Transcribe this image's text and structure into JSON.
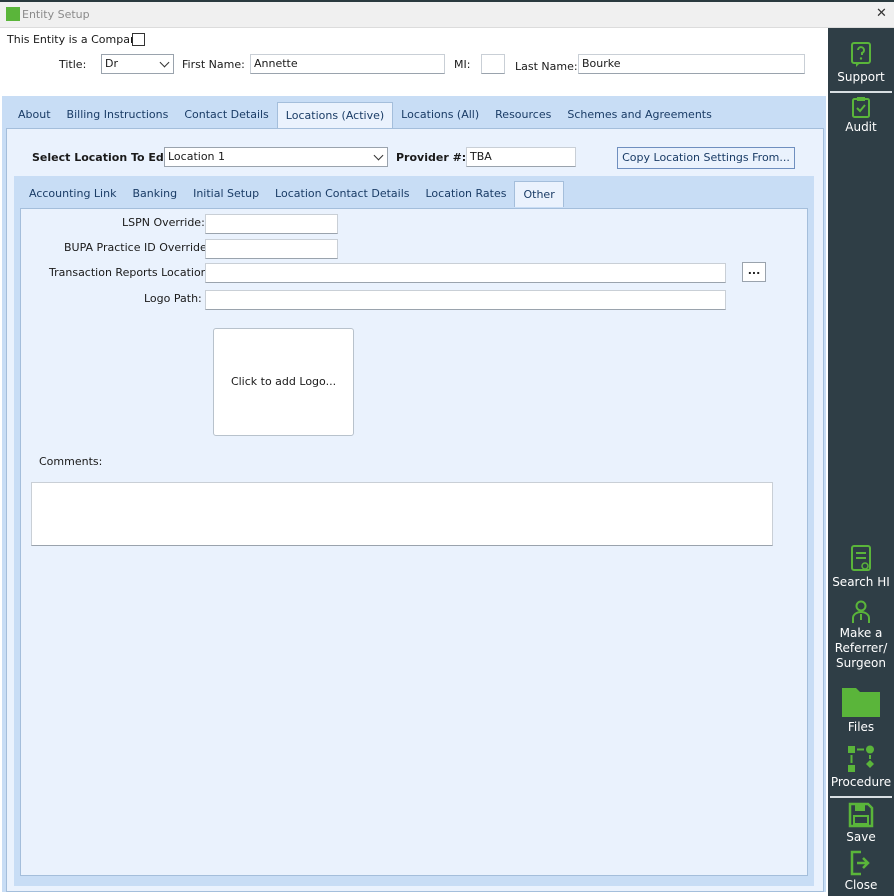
{
  "window": {
    "title": "Entity Setup",
    "close_glyph": "✕"
  },
  "header": {
    "is_company_label": "This Entity is a Company",
    "title_label": "Title:",
    "title_value": "Dr",
    "first_name_label": "First Name:",
    "first_name_value": "Annette",
    "mi_label": "MI:",
    "mi_value": "",
    "last_name_label": "Last Name:",
    "last_name_value": "Bourke"
  },
  "main_tabs": [
    {
      "label": "About"
    },
    {
      "label": "Billing Instructions"
    },
    {
      "label": "Contact Details"
    },
    {
      "label": "Locations (Active)"
    },
    {
      "label": "Locations (All)"
    },
    {
      "label": "Resources"
    },
    {
      "label": "Schemes and Agreements"
    }
  ],
  "location": {
    "select_label": "Select Location To Edit:",
    "select_value": "Location 1",
    "provider_label": "Provider #:",
    "provider_value": "TBA",
    "copy_button": "Copy Location Settings From..."
  },
  "sub_tabs": [
    {
      "label": "Accounting Link"
    },
    {
      "label": "Banking"
    },
    {
      "label": "Initial Setup"
    },
    {
      "label": "Location Contact Details"
    },
    {
      "label": "Location Rates"
    },
    {
      "label": "Other"
    }
  ],
  "other": {
    "lspn_label": "LSPN Override:",
    "lspn_value": "",
    "bupa_label": "BUPA Practice ID Override:",
    "bupa_value": "",
    "reports_label": "Transaction Reports Location:",
    "reports_value": "",
    "browse_button": "...",
    "logo_path_label": "Logo Path:",
    "logo_path_value": "",
    "logo_placeholder": "Click to add Logo...",
    "comments_label": "Comments:",
    "comments_value": ""
  },
  "sidebar": {
    "support": "Support",
    "audit": "Audit",
    "search_hi": "Search HI",
    "make_referrer_1": "Make a",
    "make_referrer_2": "Referrer/",
    "make_referrer_3": "Surgeon",
    "files": "Files",
    "procedure": "Procedure",
    "save": "Save",
    "close": "Close"
  },
  "colors": {
    "accent_green": "#5ab53a",
    "sidebar_bg": "#2f3e46",
    "panel_blue": "#c8ddf5"
  }
}
